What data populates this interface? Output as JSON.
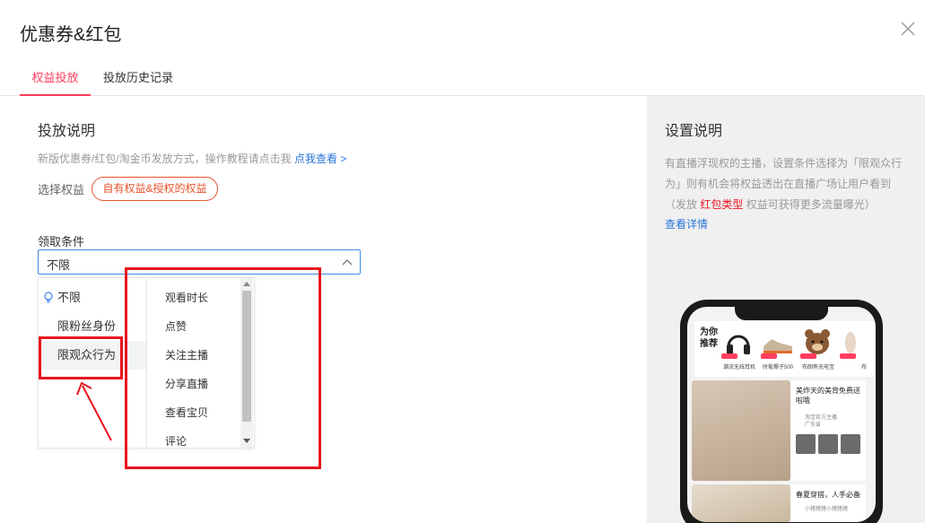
{
  "dialog": {
    "title": "优惠券&红包"
  },
  "tabs": [
    {
      "label": "权益投放",
      "active": true
    },
    {
      "label": "投放历史记录",
      "active": false
    }
  ],
  "main": {
    "section_title": "投放说明",
    "desc_text": "新版优惠券/红包/淘金币发放方式，操作教程请点击我",
    "desc_link": "点我查看 >",
    "right_label": "选择权益",
    "right_pill": "自有权益&授权的权益",
    "cond_label": "领取条件",
    "select_value": "不限",
    "options_left": [
      "不限",
      "限粉丝身份",
      "限观众行为"
    ],
    "options_right": [
      "观看时长",
      "点赞",
      "关注主播",
      "分享直播",
      "查看宝贝",
      "评论"
    ]
  },
  "side_panel": {
    "title": "设置说明",
    "desc_before": "有直播浮现权的主播，设置条件选择为「限观众行为」则有机会将权益透出在直播广场让用户看到（发放",
    "desc_emph": "红包类型",
    "desc_after": "权益可获得更多流量曝光）",
    "link": "查看详情"
  },
  "phone": {
    "rec_title": "为你推荐",
    "rec_items": [
      "潮流无线耳机",
      "时髦椰子500",
      "布朗熊充电宝",
      "布"
    ],
    "card1_title": "美炸天的美背免费送啦哦",
    "card1_sub": "淘宝官方主播",
    "card1_loc": "广东省",
    "card2_title": "春夏穿搭，人手必备",
    "card2_sub": "小猪猪猪小猪猪猪"
  },
  "colors": {
    "accent": "#ff3d5f",
    "link": "#2a74d8",
    "pill": "#e8542e",
    "annotation": "#e8141e",
    "select_border": "#3c89e8"
  }
}
